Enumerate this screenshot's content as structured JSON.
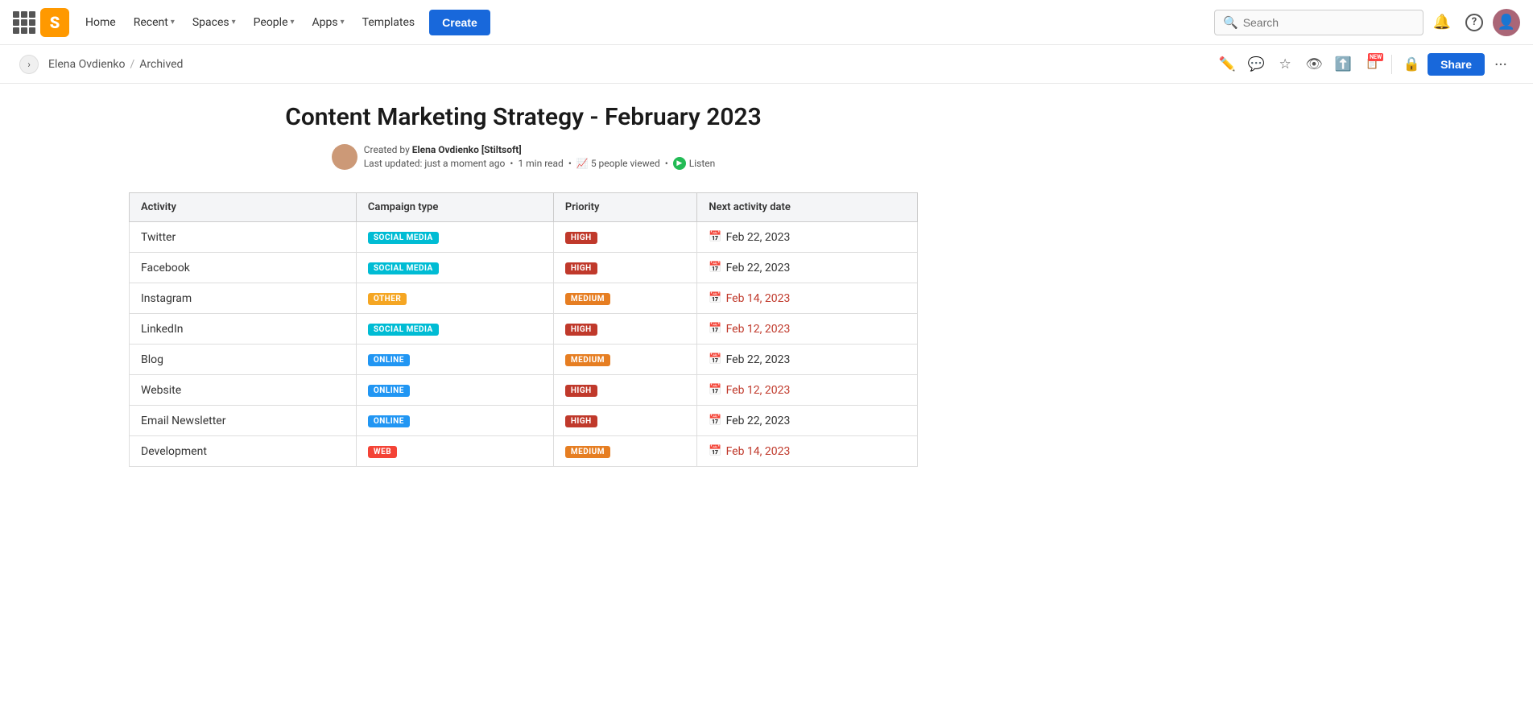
{
  "topnav": {
    "logo_letter": "S",
    "links": [
      {
        "label": "Home",
        "has_chevron": false
      },
      {
        "label": "Recent",
        "has_chevron": true
      },
      {
        "label": "Spaces",
        "has_chevron": true
      },
      {
        "label": "People",
        "has_chevron": true
      },
      {
        "label": "Apps",
        "has_chevron": true
      },
      {
        "label": "Templates",
        "has_chevron": false
      }
    ],
    "create_label": "Create",
    "search_placeholder": "Search"
  },
  "breadcrumb": {
    "parent": "Elena Ovdienko",
    "current": "Archived"
  },
  "page_actions": {
    "share_label": "Share",
    "more_label": "···"
  },
  "page": {
    "title": "Content Marketing Strategy - February 2023",
    "author": "Elena Ovdienko [Stiltsoft]",
    "last_updated": "just a moment ago",
    "read_time": "1 min read",
    "viewers": "5 people viewed",
    "listen_label": "Listen",
    "created_by_prefix": "Created by"
  },
  "table": {
    "headers": [
      "Activity",
      "Campaign type",
      "Priority",
      "Next activity date"
    ],
    "rows": [
      {
        "activity": "Twitter",
        "campaign_type": "SOCIAL MEDIA",
        "campaign_badge": "social-media",
        "priority": "HIGH",
        "priority_badge": "high",
        "date": "Feb 22, 2023",
        "date_overdue": false
      },
      {
        "activity": "Facebook",
        "campaign_type": "SOCIAL MEDIA",
        "campaign_badge": "social-media",
        "priority": "HIGH",
        "priority_badge": "high",
        "date": "Feb 22, 2023",
        "date_overdue": false
      },
      {
        "activity": "Instagram",
        "campaign_type": "OTHER",
        "campaign_badge": "other",
        "priority": "MEDIUM",
        "priority_badge": "medium",
        "date": "Feb 14, 2023",
        "date_overdue": true
      },
      {
        "activity": "LinkedIn",
        "campaign_type": "SOCIAL MEDIA",
        "campaign_badge": "social-media",
        "priority": "HIGH",
        "priority_badge": "high",
        "date": "Feb 12, 2023",
        "date_overdue": true
      },
      {
        "activity": "Blog",
        "campaign_type": "ONLINE",
        "campaign_badge": "online",
        "priority": "MEDIUM",
        "priority_badge": "medium",
        "date": "Feb 22, 2023",
        "date_overdue": false
      },
      {
        "activity": "Website",
        "campaign_type": "ONLINE",
        "campaign_badge": "online",
        "priority": "HIGH",
        "priority_badge": "high",
        "date": "Feb 12, 2023",
        "date_overdue": true
      },
      {
        "activity": "Email Newsletter",
        "campaign_type": "ONLINE",
        "campaign_badge": "online",
        "priority": "HIGH",
        "priority_badge": "high",
        "date": "Feb 22, 2023",
        "date_overdue": false
      },
      {
        "activity": "Development",
        "campaign_type": "WEB",
        "campaign_badge": "web",
        "priority": "MEDIUM",
        "priority_badge": "medium",
        "date": "Feb 14, 2023",
        "date_overdue": true
      }
    ]
  }
}
